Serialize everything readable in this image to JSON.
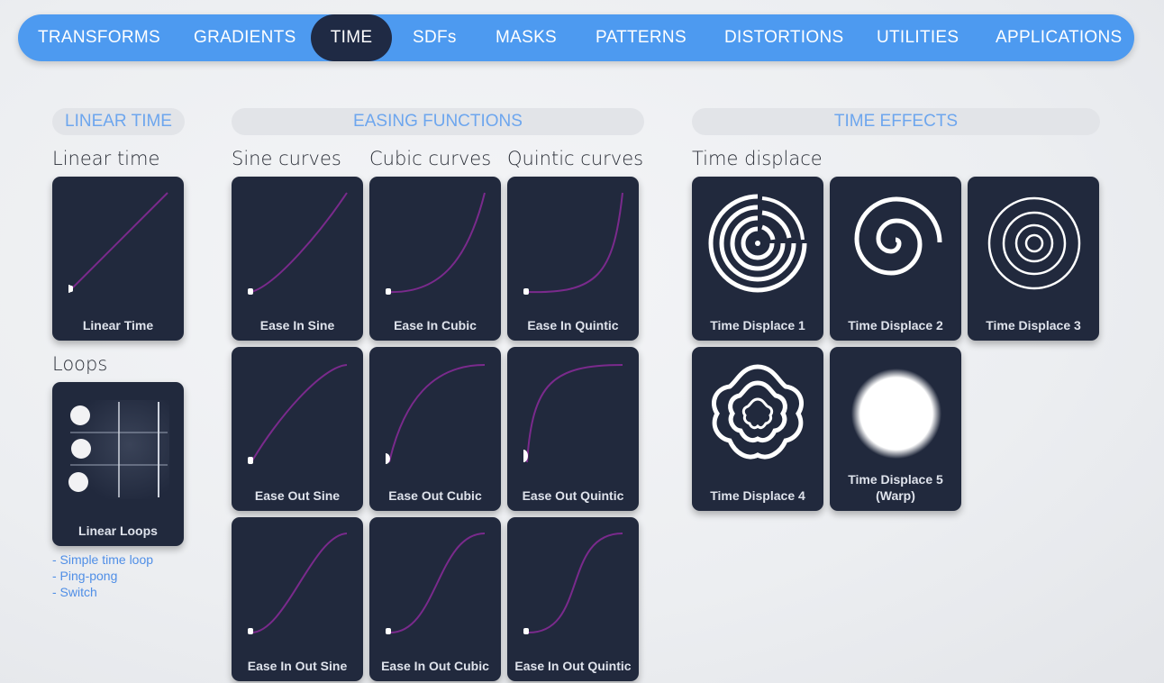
{
  "nav": {
    "tabs": [
      "TRANSFORMS",
      "GRADIENTS",
      "TIME",
      "SDFs",
      "MASKS",
      "PATTERNS",
      "DISTORTIONS",
      "UTILITIES",
      "APPLICATIONS"
    ],
    "active": "TIME"
  },
  "sections": {
    "linear_time": "LINEAR TIME",
    "easing": "EASING FUNCTIONS",
    "time_effects": "TIME EFFECTS"
  },
  "subheads": {
    "linear_time": "Linear time",
    "loops": "Loops",
    "sine": "Sine curves",
    "cubic": "Cubic curves",
    "quintic": "Quintic curves",
    "time_displace": "Time displace"
  },
  "cards": {
    "linear_time": "Linear Time",
    "linear_loops": "Linear Loops",
    "ease_in_sine": "Ease In Sine",
    "ease_in_cubic": "Ease In Cubic",
    "ease_in_quintic": "Ease In Quintic",
    "ease_out_sine": "Ease Out Sine",
    "ease_out_cubic": "Ease Out Cubic",
    "ease_out_quintic": "Ease Out Quintic",
    "ease_in_out_sine": "Ease In Out Sine",
    "ease_in_out_cubic": "Ease In Out Cubic",
    "ease_in_out_quintic": "Ease In Out Quintic",
    "time_displace_1": "Time Displace 1",
    "time_displace_2": "Time Displace 2",
    "time_displace_3": "Time Displace 3",
    "time_displace_4": "Time Displace 4",
    "time_displace_5": "Time Displace 5 (Warp)"
  },
  "loop_links": [
    "- Simple time loop",
    "- Ping-pong",
    "- Switch"
  ],
  "colors": {
    "nav_bg": "#4d9af0",
    "nav_active": "#1f2a44",
    "card_bg": "#21293d",
    "curve": "#7a2a8c",
    "section_text": "#6da6ee",
    "link": "#4f8ee6"
  }
}
